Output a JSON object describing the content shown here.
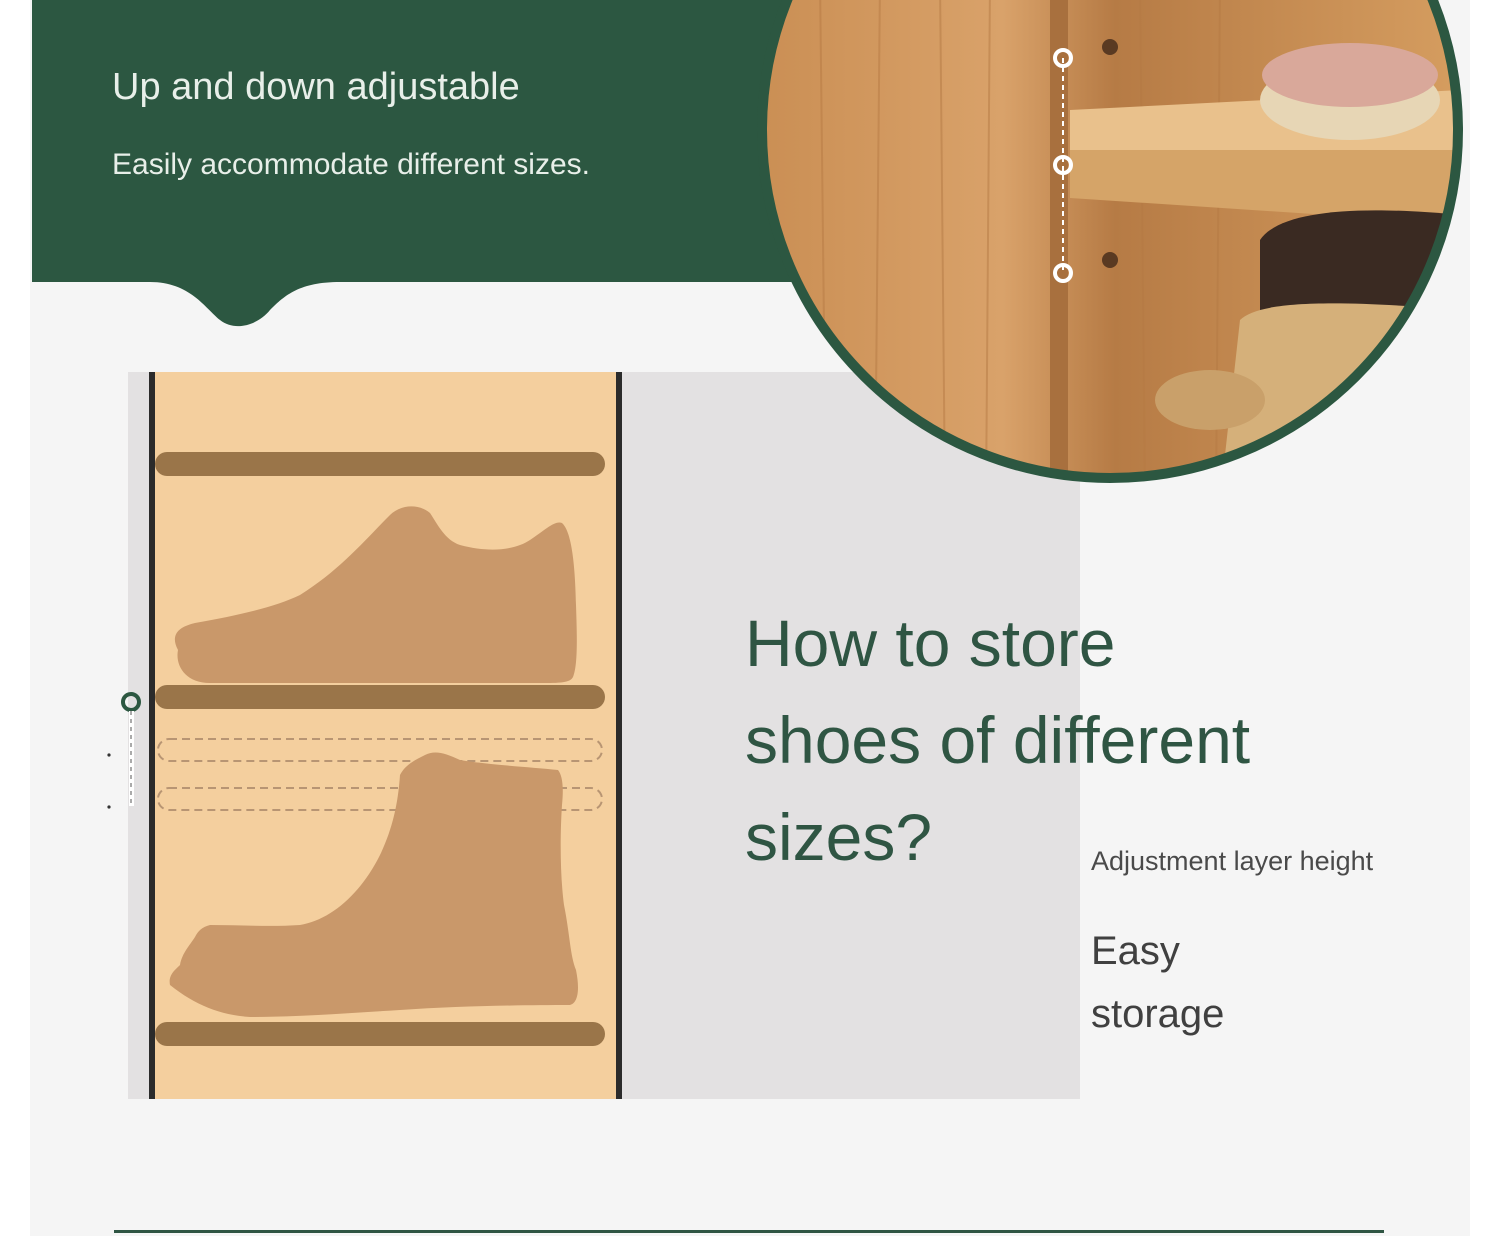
{
  "banner": {
    "title": "Up and down adjustable",
    "subtitle": "Easily accommodate different sizes."
  },
  "headline": {
    "lines": [
      "How to store",
      "shoes of different",
      "sizes?"
    ]
  },
  "notes": {
    "adjustment": "Adjustment layer height",
    "easy_lines": [
      "Easy",
      "storage"
    ]
  },
  "colors": {
    "brand_green": "#2c5741",
    "headline_green": "#2f5543",
    "cabinet_tan": "#f4cf9e",
    "shelf_brown": "#9a7549",
    "shoe_tan": "#c9986a",
    "panel_grey": "#e3e1e2"
  },
  "illustration": {
    "shoes": [
      "sneaker-icon",
      "boot-icon"
    ],
    "adjustable_shelf_positions_shown": 2
  }
}
